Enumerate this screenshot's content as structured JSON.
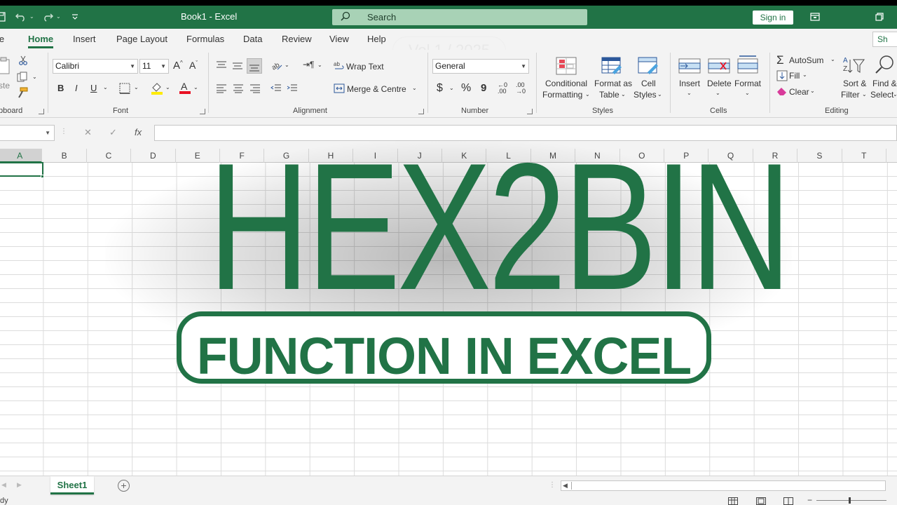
{
  "window": {
    "title": "Book1  -  Excel",
    "search_placeholder": "Search",
    "sign_in": "Sign in"
  },
  "menu": {
    "tabs": [
      {
        "label": "le"
      },
      {
        "label": "Home"
      },
      {
        "label": "Insert"
      },
      {
        "label": "Page Layout"
      },
      {
        "label": "Formulas"
      },
      {
        "label": "Data"
      },
      {
        "label": "Review"
      },
      {
        "label": "View"
      },
      {
        "label": "Help"
      }
    ],
    "share": "Sh"
  },
  "ribbon": {
    "clipboard": {
      "label": "pboard",
      "paste": "ste"
    },
    "font": {
      "label": "Font",
      "name": "Calibri",
      "size": "11",
      "bold": "B",
      "italic": "I",
      "underline": "U"
    },
    "alignment": {
      "label": "Alignment",
      "wrap_text": "Wrap Text",
      "merge_center": "Merge & Centre"
    },
    "number": {
      "label": "Number",
      "format": "General",
      "currency": "$",
      "percent": "%",
      "comma": "9"
    },
    "styles": {
      "label": "Styles",
      "conditional_formatting": [
        "Conditional",
        "Formatting"
      ],
      "format_as_table": [
        "Format as",
        "Table"
      ],
      "cell_styles": [
        "Cell",
        "Styles"
      ]
    },
    "cells": {
      "label": "Cells",
      "insert": "Insert",
      "delete": "Delete",
      "format": "Format"
    },
    "editing": {
      "label": "Editing",
      "autosum": "AutoSum",
      "fill": "Fill",
      "clear": "Clear",
      "sort_filter": [
        "Sort &",
        "Filter"
      ],
      "find_select": [
        "Find &",
        "Select"
      ]
    }
  },
  "formula_bar": {
    "cancel": "✕",
    "enter": "✓",
    "fx": "fx"
  },
  "columns": [
    "A",
    "B",
    "C",
    "D",
    "E",
    "F",
    "G",
    "H",
    "I",
    "J",
    "K",
    "L",
    "M",
    "N",
    "O",
    "P",
    "Q",
    "R",
    "S",
    "T"
  ],
  "overlay": {
    "title": "HEX2BIN",
    "subtitle": "FUNCTION IN EXCEL",
    "watermark": "Vol 1 / 2025"
  },
  "sheets": {
    "active": "Sheet1",
    "add": "+"
  },
  "status": {
    "ready": "dy"
  },
  "colors": {
    "excel_green": "#217346",
    "ribbon_bg": "#f3f3f3"
  }
}
